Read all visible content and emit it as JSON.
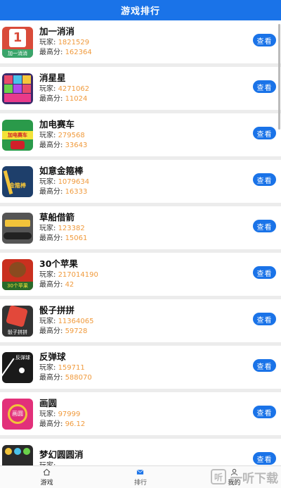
{
  "header": {
    "title": "游戏排行"
  },
  "labels": {
    "players": "玩家: ",
    "best": "最高分: ",
    "view": "查看"
  },
  "games": [
    {
      "name": "加一消消",
      "players": "1821529",
      "best": "162364",
      "icon": "plus-one-icon",
      "thumb_text": "1"
    },
    {
      "name": "消星星",
      "players": "4271062",
      "best": "11024",
      "icon": "star-blocks-icon",
      "thumb_text": ""
    },
    {
      "name": "加电赛车",
      "players": "279568",
      "best": "33643",
      "icon": "racing-car-icon",
      "thumb_text": "加电赛车"
    },
    {
      "name": "如意金箍棒",
      "players": "1079634",
      "best": "16333",
      "icon": "golden-staff-icon",
      "thumb_text": "金箍棒"
    },
    {
      "name": "草船借箭",
      "players": "123382",
      "best": "15061",
      "icon": "boat-arrow-icon",
      "thumb_text": ""
    },
    {
      "name": "30个苹果",
      "players": "217014190",
      "best": "42",
      "icon": "monkey-apple-icon",
      "thumb_text": "30个苹果"
    },
    {
      "name": "骰子拼拼",
      "players": "11364065",
      "best": "59728",
      "icon": "dice-icon",
      "thumb_text": "骰子拼拼"
    },
    {
      "name": "反弹球",
      "players": "159711",
      "best": "588070",
      "icon": "bounce-ball-icon",
      "thumb_text": "反弹球"
    },
    {
      "name": "画圆",
      "players": "97999",
      "best": "96.12",
      "icon": "draw-circle-icon",
      "thumb_text": "画圆"
    },
    {
      "name": "梦幻圆圆消",
      "players": "",
      "best": "",
      "icon": "dream-circles-icon",
      "thumb_text": ""
    }
  ],
  "tabs": [
    {
      "label": "游戏",
      "icon": "home-icon"
    },
    {
      "label": "排行",
      "icon": "mail-icon"
    },
    {
      "label": "我的",
      "icon": "user-icon"
    }
  ],
  "watermark": {
    "text": "一听下载",
    "logo": "听"
  },
  "colors": {
    "primary": "#1a73e8",
    "value": "#f09a3c"
  }
}
